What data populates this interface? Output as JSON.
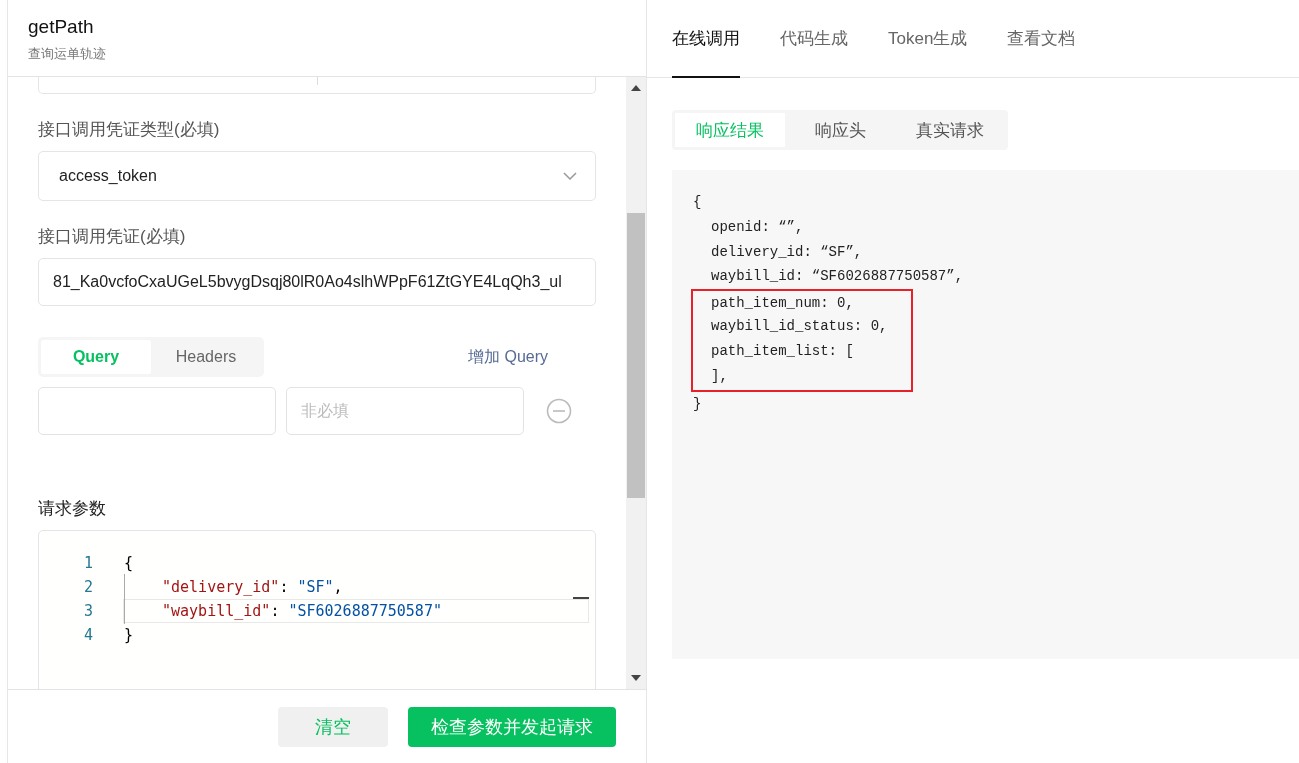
{
  "left": {
    "title": "getPath",
    "subtitle": "查询运单轨迹",
    "credential_type": {
      "label": "接口调用凭证类型(必填)",
      "value": "access_token"
    },
    "credential": {
      "label": "接口调用凭证(必填)",
      "value": "81_Ka0vcfoCxaUGeL5bvygDsqj80lR0Ao4slhWPpF61ZtGYE4LqQh3_ul"
    },
    "param_tabs": [
      {
        "label": "Query",
        "selected": true
      },
      {
        "label": "Headers",
        "selected": false
      }
    ],
    "add_link": "增加 Query",
    "param_row": {
      "value_placeholder": "非必填"
    },
    "body_label": "请求参数",
    "editor_lines": [
      {
        "number": "1",
        "active": false,
        "guide": false,
        "tokens": [
          {
            "kind": "punct",
            "text": "{"
          }
        ]
      },
      {
        "number": "2",
        "active": false,
        "guide": true,
        "tokens": [
          {
            "kind": "key",
            "text": "\"delivery_id\""
          },
          {
            "kind": "punct",
            "text": ": "
          },
          {
            "kind": "string",
            "text": "\"SF\""
          },
          {
            "kind": "punct",
            "text": ","
          }
        ]
      },
      {
        "number": "3",
        "active": true,
        "guide": true,
        "tokens": [
          {
            "kind": "key",
            "text": "\"waybill_id\""
          },
          {
            "kind": "punct",
            "text": ": "
          },
          {
            "kind": "string",
            "text": "\"SF6026887750587\""
          }
        ]
      },
      {
        "number": "4",
        "active": false,
        "guide": false,
        "tokens": [
          {
            "kind": "punct",
            "text": "}"
          }
        ]
      }
    ],
    "buttons": [
      {
        "label": "清空",
        "kind": "secondary"
      },
      {
        "label": "检查参数并发起请求",
        "kind": "primary"
      }
    ]
  },
  "right": {
    "tabs": [
      {
        "label": "在线调用",
        "selected": true
      },
      {
        "label": "代码生成",
        "selected": false
      },
      {
        "label": "Token生成",
        "selected": false
      },
      {
        "label": "查看文档",
        "selected": false
      }
    ],
    "result_tabs": [
      {
        "label": "响应结果",
        "selected": true
      },
      {
        "label": "响应头",
        "selected": false
      },
      {
        "label": "真实请求",
        "selected": false
      }
    ],
    "response_lines": [
      {
        "text": "{",
        "indent": false,
        "highlighted": false
      },
      {
        "text": "openid: “”,",
        "indent": true,
        "highlighted": false
      },
      {
        "text": "delivery_id: “SF”,",
        "indent": true,
        "highlighted": false
      },
      {
        "text": "waybill_id: “SF6026887750587”,",
        "indent": true,
        "highlighted": false
      },
      {
        "text": "path_item_num: 0,",
        "indent": true,
        "highlighted": true
      },
      {
        "text": "waybill_id_status: 0,",
        "indent": true,
        "highlighted": true
      },
      {
        "text": "path_item_list: [",
        "indent": true,
        "highlighted": true
      },
      {
        "text": "],",
        "indent": true,
        "highlighted": true
      },
      {
        "text": "}",
        "indent": false,
        "highlighted": false
      }
    ]
  }
}
